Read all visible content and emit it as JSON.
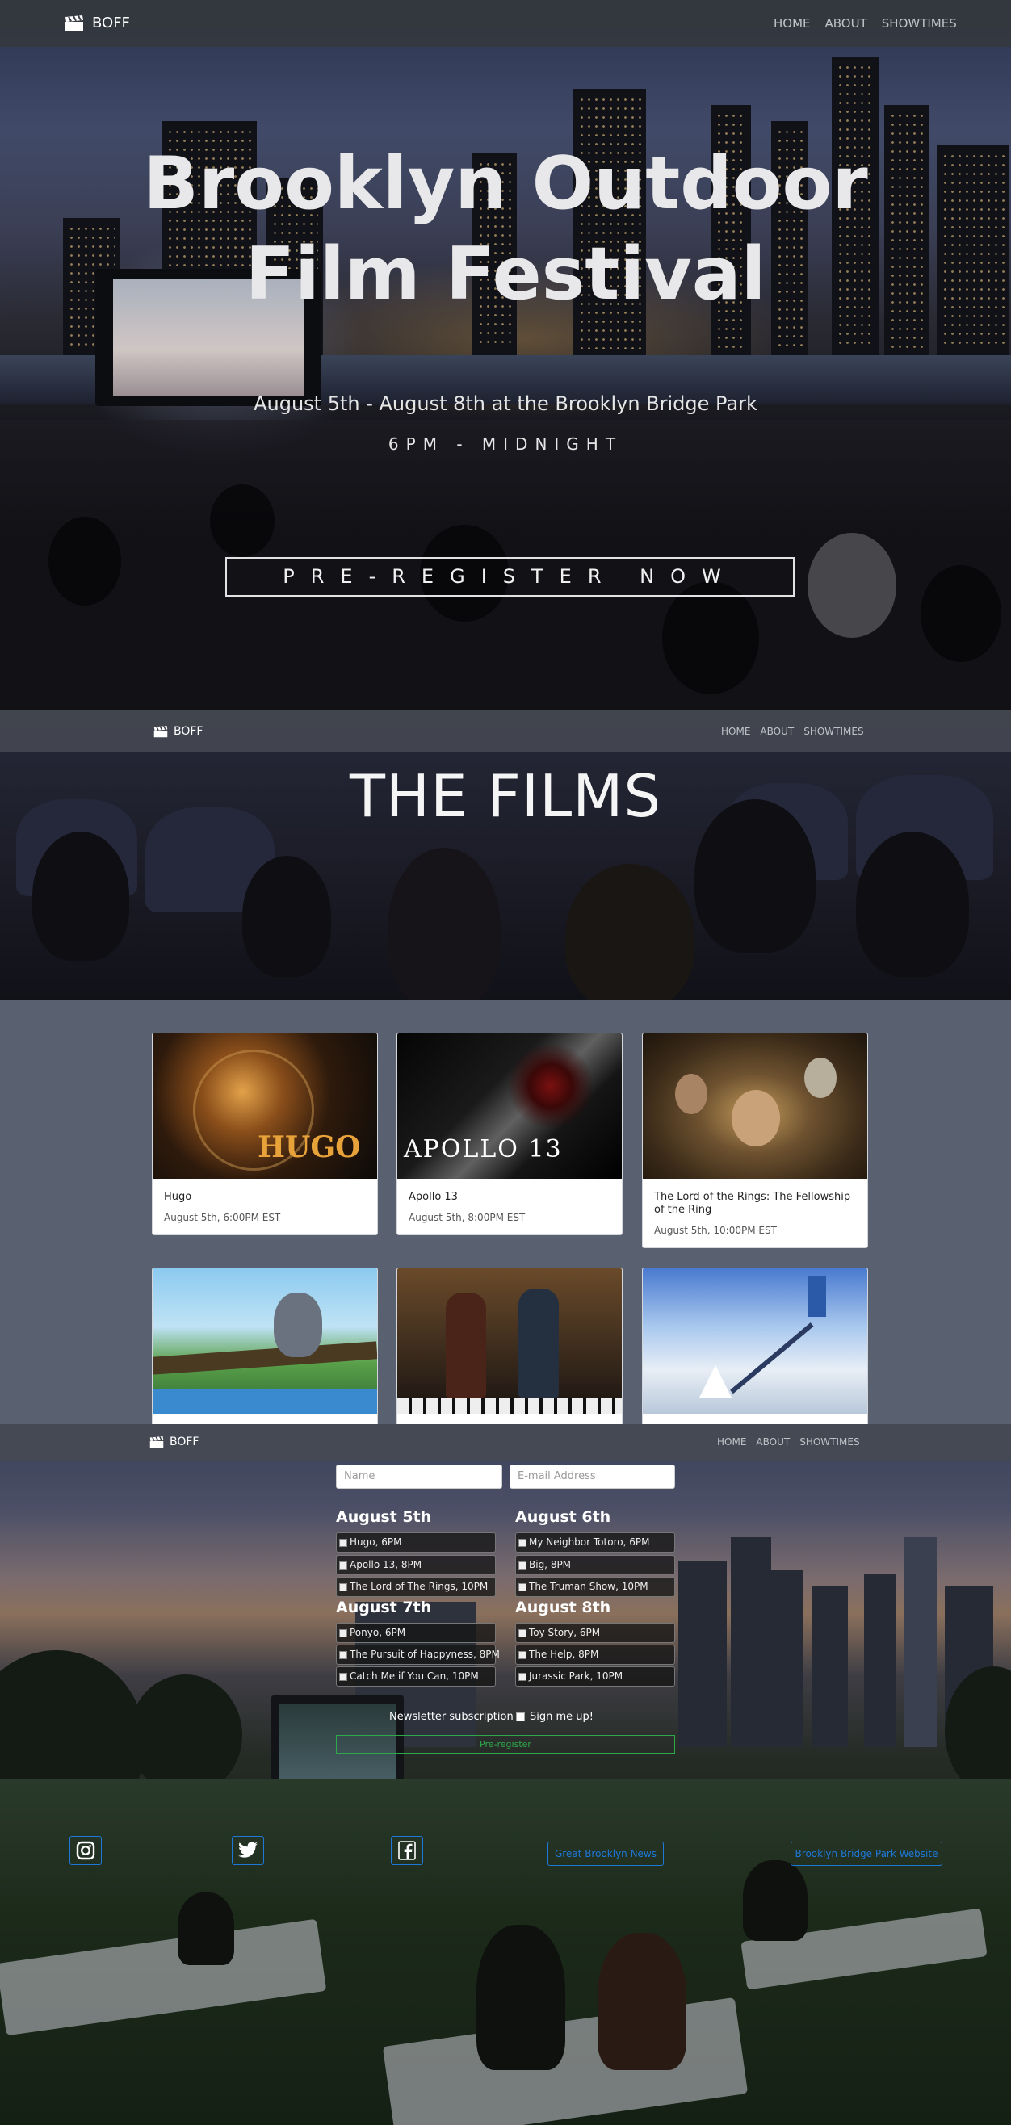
{
  "nav": {
    "brand": "BOFF",
    "links": [
      "HOME",
      "ABOUT",
      "SHOWTIMES"
    ]
  },
  "hero": {
    "title_line1": "Brooklyn Outdoor",
    "title_line2": "Film Festival",
    "dates": "August 5th - August 8th at the Brooklyn Bridge Park",
    "hours": "6PM - MIDNIGHT",
    "cta": "PRE-REGISTER NOW"
  },
  "films": {
    "heading": "THE FILMS",
    "cards": [
      {
        "title": "Hugo",
        "when": "August 5th, 6:00PM EST",
        "poster_text": "HUGO"
      },
      {
        "title": "Apollo 13",
        "when": "August 5th, 8:00PM EST",
        "poster_text": "APOLLO 13"
      },
      {
        "title": "The Lord of the Rings: The Fellowship of the Ring",
        "when": "August 5th, 10:00PM EST",
        "poster_text": ""
      },
      {
        "title": "",
        "when": "",
        "poster_text": ""
      },
      {
        "title": "",
        "when": "",
        "poster_text": ""
      },
      {
        "title": "",
        "when": "",
        "poster_text": ""
      }
    ]
  },
  "form": {
    "name_placeholder": "Name",
    "email_placeholder": "E-mail Address",
    "days": [
      {
        "label": "August 5th",
        "slots": [
          "Hugo, 6PM",
          "Apollo 13, 8PM",
          "The Lord of The Rings, 10PM"
        ]
      },
      {
        "label": "August 6th",
        "slots": [
          "My Neighbor Totoro, 6PM",
          "Big, 8PM",
          "The Truman Show, 10PM"
        ]
      },
      {
        "label": "August 7th",
        "slots": [
          "Ponyo, 6PM",
          "The Pursuit of Happyness, 8PM",
          "Catch Me if You Can, 10PM"
        ]
      },
      {
        "label": "August 8th",
        "slots": [
          "Toy Story, 6PM",
          "The Help, 8PM",
          "Jurassic Park, 10PM"
        ]
      }
    ],
    "newsletter_label": "Newsletter subscription",
    "signup_label": "Sign me up!",
    "submit": "Pre-register"
  },
  "footer": {
    "social_icons": [
      "instagram-icon",
      "twitter-icon",
      "facebook-icon"
    ],
    "link1": "Great Brooklyn News",
    "link2": "Brooklyn Bridge Park Website"
  },
  "colors": {
    "accent_blue": "#1e78d8",
    "accent_green": "#2ea84a",
    "card_section_bg": "#596070"
  }
}
